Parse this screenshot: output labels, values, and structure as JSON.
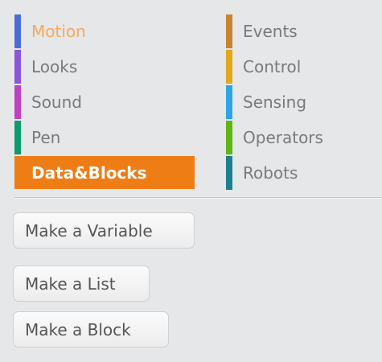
{
  "categories": {
    "left": [
      {
        "label": "Motion",
        "color": "#4a6cd4",
        "state": "highlight"
      },
      {
        "label": "Looks",
        "color": "#8a55d7",
        "state": "normal"
      },
      {
        "label": "Sound",
        "color": "#bb42c3",
        "state": "normal"
      },
      {
        "label": "Pen",
        "color": "#0e9a6c",
        "state": "normal"
      },
      {
        "label": "Data&Blocks",
        "color": "#ee7d16",
        "state": "selected"
      }
    ],
    "right": [
      {
        "label": "Events",
        "color": "#c88330",
        "state": "normal"
      },
      {
        "label": "Control",
        "color": "#e1a91a",
        "state": "normal"
      },
      {
        "label": "Sensing",
        "color": "#2ca5e2",
        "state": "normal"
      },
      {
        "label": "Operators",
        "color": "#5cb712",
        "state": "normal"
      },
      {
        "label": "Robots",
        "color": "#1b8191",
        "state": "normal"
      }
    ]
  },
  "buttons": {
    "make_variable": "Make a Variable",
    "make_list": "Make a List",
    "make_block": "Make a Block"
  },
  "colors": {
    "background": "#e6e7e8",
    "text_inactive": "#7a7a7a",
    "text_highlight": "#f7a95d",
    "selected_fill": "#ee7d16"
  }
}
